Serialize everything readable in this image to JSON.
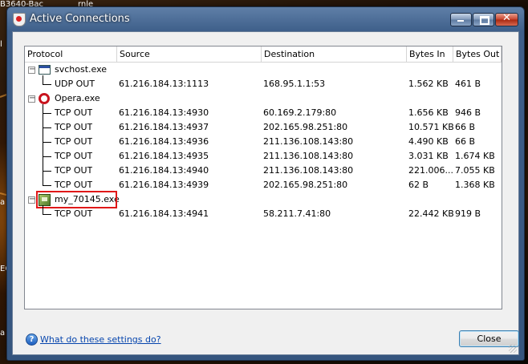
{
  "desktop": {
    "texts": [
      "B3640-Bac",
      "rnle",
      "l",
      "a",
      "a",
      "EC"
    ]
  },
  "window": {
    "title": "Active Connections",
    "buttons": {
      "minimize": "minimize",
      "maximize": "maximize",
      "close": "close"
    }
  },
  "columns": [
    "Protocol",
    "Source",
    "Destination",
    "Bytes In",
    "Bytes Out"
  ],
  "processes": [
    {
      "name": "svchost.exe",
      "icon": "window-app-icon",
      "connections": [
        {
          "protocol": "UDP OUT",
          "source": "61.216.184.13:1113",
          "destination": "168.95.1.1:53",
          "bytes_in": "1.562 KB",
          "bytes_out": "461 B"
        }
      ]
    },
    {
      "name": "Opera.exe",
      "icon": "opera-icon",
      "connections": [
        {
          "protocol": "TCP OUT",
          "source": "61.216.184.13:4930",
          "destination": "60.169.2.179:80",
          "bytes_in": "1.656 KB",
          "bytes_out": "946 B"
        },
        {
          "protocol": "TCP OUT",
          "source": "61.216.184.13:4937",
          "destination": "202.165.98.251:80",
          "bytes_in": "10.571 KB",
          "bytes_out": "66 B"
        },
        {
          "protocol": "TCP OUT",
          "source": "61.216.184.13:4936",
          "destination": "211.136.108.143:80",
          "bytes_in": "4.490 KB",
          "bytes_out": "66 B"
        },
        {
          "protocol": "TCP OUT",
          "source": "61.216.184.13:4935",
          "destination": "211.136.108.143:80",
          "bytes_in": "3.031 KB",
          "bytes_out": "1.674 KB"
        },
        {
          "protocol": "TCP OUT",
          "source": "61.216.184.13:4940",
          "destination": "211.136.108.143:80",
          "bytes_in": "221.006...",
          "bytes_out": "7.055 KB"
        },
        {
          "protocol": "TCP OUT",
          "source": "61.216.184.13:4939",
          "destination": "202.165.98.251:80",
          "bytes_in": "62 B",
          "bytes_out": "1.368 KB"
        }
      ]
    },
    {
      "name": "my_70145.exe",
      "icon": "green-app-icon",
      "highlighted": true,
      "connections": [
        {
          "protocol": "TCP OUT",
          "source": "61.216.184.13:4941",
          "destination": "58.211.7.41:80",
          "bytes_in": "22.442 KB",
          "bytes_out": "919 B"
        }
      ]
    }
  ],
  "footer": {
    "help_link": "What do these settings do?",
    "close_button": "Close"
  },
  "colors": {
    "highlight": "#e01818",
    "link": "#0645ad"
  }
}
